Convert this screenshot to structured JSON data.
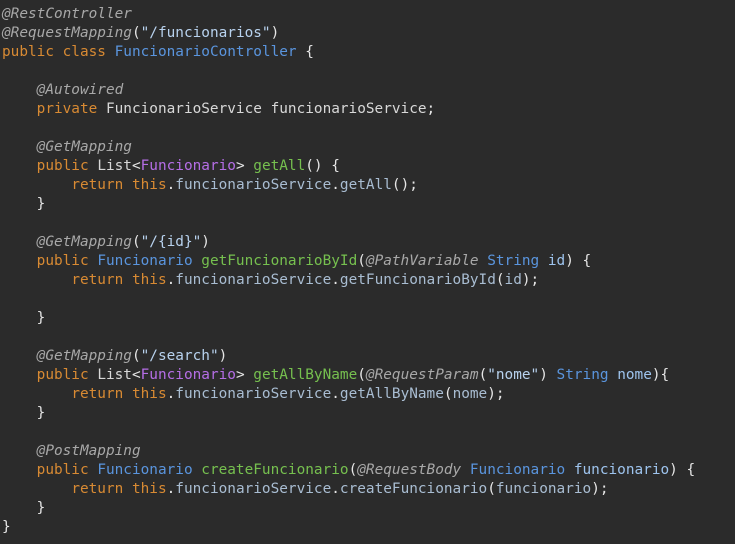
{
  "editor": {
    "lines": [
      [
        {
          "t": "@RestController",
          "c": "annotation"
        }
      ],
      [
        {
          "t": "@RequestMapping",
          "c": "annotation"
        },
        {
          "t": "(",
          "c": "punct"
        },
        {
          "t": "\"/funcionarios\"",
          "c": "string"
        },
        {
          "t": ")",
          "c": "punct"
        }
      ],
      [
        {
          "t": "public class ",
          "c": "keyword"
        },
        {
          "t": "FuncionarioController",
          "c": "type"
        },
        {
          "t": " {",
          "c": "punct"
        }
      ],
      [],
      [
        {
          "t": "    ",
          "c": "plain"
        },
        {
          "t": "@Autowired",
          "c": "annotation"
        }
      ],
      [
        {
          "t": "    ",
          "c": "plain"
        },
        {
          "t": "private ",
          "c": "keyword"
        },
        {
          "t": "FuncionarioService funcionarioService",
          "c": "plain"
        },
        {
          "t": ";",
          "c": "punct"
        }
      ],
      [],
      [
        {
          "t": "    ",
          "c": "plain"
        },
        {
          "t": "@GetMapping",
          "c": "annotation"
        }
      ],
      [
        {
          "t": "    ",
          "c": "plain"
        },
        {
          "t": "public ",
          "c": "keyword"
        },
        {
          "t": "List",
          "c": "plain"
        },
        {
          "t": "<",
          "c": "punct"
        },
        {
          "t": "Funcionario",
          "c": "generic"
        },
        {
          "t": "> ",
          "c": "punct"
        },
        {
          "t": "getAll",
          "c": "method"
        },
        {
          "t": "() {",
          "c": "punct"
        }
      ],
      [
        {
          "t": "        ",
          "c": "plain"
        },
        {
          "t": "return this",
          "c": "keyword"
        },
        {
          "t": ".",
          "c": "punct"
        },
        {
          "t": "funcionarioService",
          "c": "field"
        },
        {
          "t": ".",
          "c": "punct"
        },
        {
          "t": "getAll",
          "c": "field"
        },
        {
          "t": "();",
          "c": "punct"
        }
      ],
      [
        {
          "t": "    }",
          "c": "punct"
        }
      ],
      [],
      [
        {
          "t": "    ",
          "c": "plain"
        },
        {
          "t": "@GetMapping",
          "c": "annotation"
        },
        {
          "t": "(",
          "c": "punct"
        },
        {
          "t": "\"/{id}\"",
          "c": "string"
        },
        {
          "t": ")",
          "c": "punct"
        }
      ],
      [
        {
          "t": "    ",
          "c": "plain"
        },
        {
          "t": "public ",
          "c": "keyword"
        },
        {
          "t": "Funcionario ",
          "c": "type"
        },
        {
          "t": "getFuncionarioById",
          "c": "method"
        },
        {
          "t": "(",
          "c": "punct"
        },
        {
          "t": "@PathVariable ",
          "c": "annotation"
        },
        {
          "t": "String ",
          "c": "type"
        },
        {
          "t": "id",
          "c": "param"
        },
        {
          "t": ") {",
          "c": "punct"
        }
      ],
      [
        {
          "t": "        ",
          "c": "plain"
        },
        {
          "t": "return this",
          "c": "keyword"
        },
        {
          "t": ".",
          "c": "punct"
        },
        {
          "t": "funcionarioService",
          "c": "field"
        },
        {
          "t": ".",
          "c": "punct"
        },
        {
          "t": "getFuncionarioById",
          "c": "field"
        },
        {
          "t": "(",
          "c": "punct"
        },
        {
          "t": "id",
          "c": "field"
        },
        {
          "t": ");",
          "c": "punct"
        }
      ],
      [],
      [
        {
          "t": "    }",
          "c": "punct"
        }
      ],
      [],
      [
        {
          "t": "    ",
          "c": "plain"
        },
        {
          "t": "@GetMapping",
          "c": "annotation"
        },
        {
          "t": "(",
          "c": "punct"
        },
        {
          "t": "\"/search\"",
          "c": "string"
        },
        {
          "t": ")",
          "c": "punct"
        }
      ],
      [
        {
          "t": "    ",
          "c": "plain"
        },
        {
          "t": "public ",
          "c": "keyword"
        },
        {
          "t": "List",
          "c": "plain"
        },
        {
          "t": "<",
          "c": "punct"
        },
        {
          "t": "Funcionario",
          "c": "generic"
        },
        {
          "t": "> ",
          "c": "punct"
        },
        {
          "t": "getAllByName",
          "c": "method"
        },
        {
          "t": "(",
          "c": "punct"
        },
        {
          "t": "@RequestParam",
          "c": "annotation"
        },
        {
          "t": "(",
          "c": "punct"
        },
        {
          "t": "\"nome\"",
          "c": "string"
        },
        {
          "t": ") ",
          "c": "punct"
        },
        {
          "t": "String ",
          "c": "type"
        },
        {
          "t": "nome",
          "c": "param"
        },
        {
          "t": "){",
          "c": "punct"
        }
      ],
      [
        {
          "t": "        ",
          "c": "plain"
        },
        {
          "t": "return this",
          "c": "keyword"
        },
        {
          "t": ".",
          "c": "punct"
        },
        {
          "t": "funcionarioService",
          "c": "field"
        },
        {
          "t": ".",
          "c": "punct"
        },
        {
          "t": "getAllByName",
          "c": "field"
        },
        {
          "t": "(",
          "c": "punct"
        },
        {
          "t": "nome",
          "c": "field"
        },
        {
          "t": ");",
          "c": "punct"
        }
      ],
      [
        {
          "t": "    }",
          "c": "punct"
        }
      ],
      [],
      [
        {
          "t": "    ",
          "c": "plain"
        },
        {
          "t": "@PostMapping",
          "c": "annotation"
        }
      ],
      [
        {
          "t": "    ",
          "c": "plain"
        },
        {
          "t": "public ",
          "c": "keyword"
        },
        {
          "t": "Funcionario ",
          "c": "type"
        },
        {
          "t": "createFuncionario",
          "c": "method"
        },
        {
          "t": "(",
          "c": "punct"
        },
        {
          "t": "@RequestBody ",
          "c": "annotation"
        },
        {
          "t": "Funcionario ",
          "c": "type"
        },
        {
          "t": "funcionario",
          "c": "param"
        },
        {
          "t": ") {",
          "c": "punct"
        }
      ],
      [
        {
          "t": "        ",
          "c": "plain"
        },
        {
          "t": "return this",
          "c": "keyword"
        },
        {
          "t": ".",
          "c": "punct"
        },
        {
          "t": "funcionarioService",
          "c": "field"
        },
        {
          "t": ".",
          "c": "punct"
        },
        {
          "t": "createFuncionario",
          "c": "field"
        },
        {
          "t": "(",
          "c": "punct"
        },
        {
          "t": "funcionario",
          "c": "field"
        },
        {
          "t": ");",
          "c": "punct"
        }
      ],
      [
        {
          "t": "    }",
          "c": "punct"
        }
      ],
      [
        {
          "t": "}",
          "c": "punct"
        }
      ]
    ]
  }
}
